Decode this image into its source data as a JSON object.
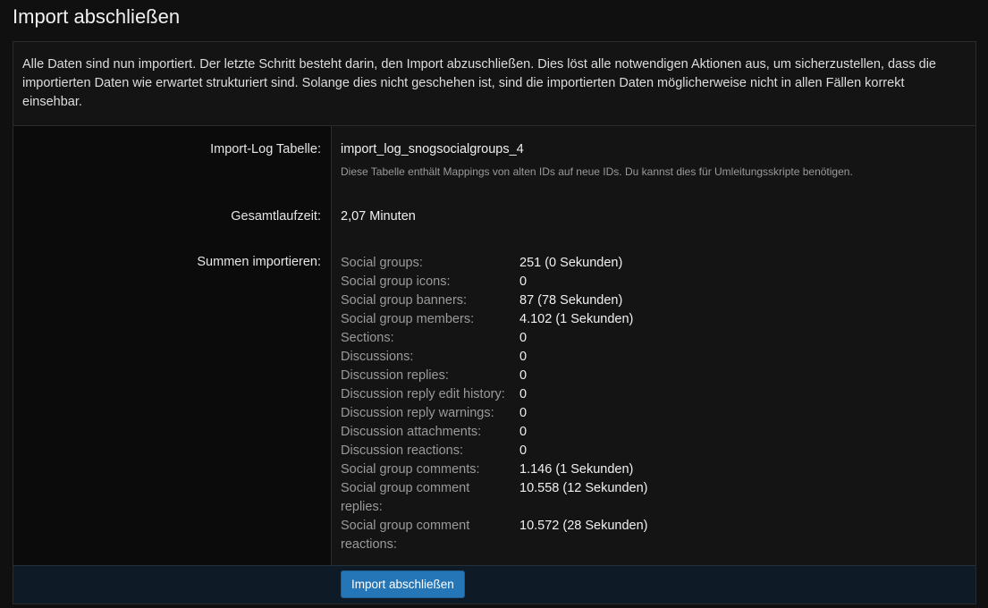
{
  "page": {
    "title": "Import abschließen"
  },
  "intro": "Alle Daten sind nun importiert. Der letzte Schritt besteht darin, den Import abzuschließen. Dies löst alle notwendigen Aktionen aus, um sicherzustellen, dass die importierten Daten wie erwartet strukturiert sind. Solange dies nicht geschehen ist, sind die importierten Daten möglicherweise nicht in allen Fällen korrekt einsehbar.",
  "log_table": {
    "label": "Import-Log Tabelle:",
    "value": "import_log_snogsocialgroups_4",
    "hint": "Diese Tabelle enthält Mappings von alten IDs auf neue IDs. Du kannst dies für Umleitungsskripte benötigen."
  },
  "runtime": {
    "label": "Gesamtlaufzeit:",
    "value": "2,07 Minuten"
  },
  "totals": {
    "label": "Summen importieren:",
    "rows": [
      {
        "name": "Social groups:",
        "value": "251 (0 Sekunden)"
      },
      {
        "name": "Social group icons:",
        "value": "0"
      },
      {
        "name": "Social group banners:",
        "value": "87 (78 Sekunden)"
      },
      {
        "name": "Social group members:",
        "value": "4.102 (1 Sekunden)"
      },
      {
        "name": "Sections:",
        "value": "0"
      },
      {
        "name": "Discussions:",
        "value": "0"
      },
      {
        "name": "Discussion replies:",
        "value": "0"
      },
      {
        "name": "Discussion reply edit history:",
        "value": "0"
      },
      {
        "name": "Discussion reply warnings:",
        "value": "0"
      },
      {
        "name": "Discussion attachments:",
        "value": "0"
      },
      {
        "name": "Discussion reactions:",
        "value": "0"
      },
      {
        "name": "Social group comments:",
        "value": "1.146 (1 Sekunden)"
      },
      {
        "name": "Social group comment replies:",
        "value": "10.558 (12 Sekunden)"
      },
      {
        "name": "Social group comment reactions:",
        "value": "10.572 (28 Sekunden)"
      }
    ]
  },
  "footer": {
    "button_label": "Import abschließen"
  },
  "colors": {
    "accent": "#2576b7",
    "background": "#101010",
    "footer": "#0e1b27"
  }
}
